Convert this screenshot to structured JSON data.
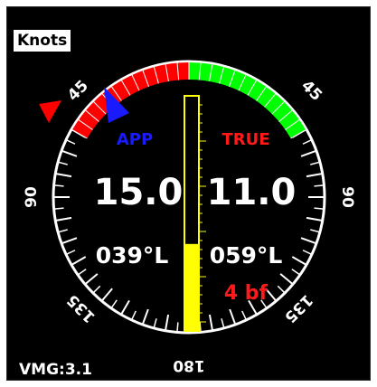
{
  "units_label": "Knots",
  "colors": {
    "background": "#000000",
    "dial": "#ffffff",
    "port_red": "#ff0000",
    "starboard_green": "#00ff00",
    "apparent_blue": "#1a1aff",
    "true_red": "#ff1a1a",
    "bar_yellow": "#ffff00"
  },
  "dial": {
    "label_45_left": "45",
    "label_45_right": "45",
    "label_90_left": "90",
    "label_90_right": "90",
    "label_135_left": "135",
    "label_135_right": "135",
    "label_180": "180"
  },
  "apparent": {
    "label": "APP",
    "speed": "15.0",
    "angle": "039°L",
    "arrow_icon": "blue-triangle-pointer"
  },
  "true_wind": {
    "label": "TRUE",
    "speed": "11.0",
    "angle": "059°L",
    "beaufort": "4 bf",
    "arrow_icon": "red-triangle-pointer"
  },
  "speed_bar": {
    "fill_fraction": 0.37
  },
  "vmg_text": "VMG:3.1"
}
